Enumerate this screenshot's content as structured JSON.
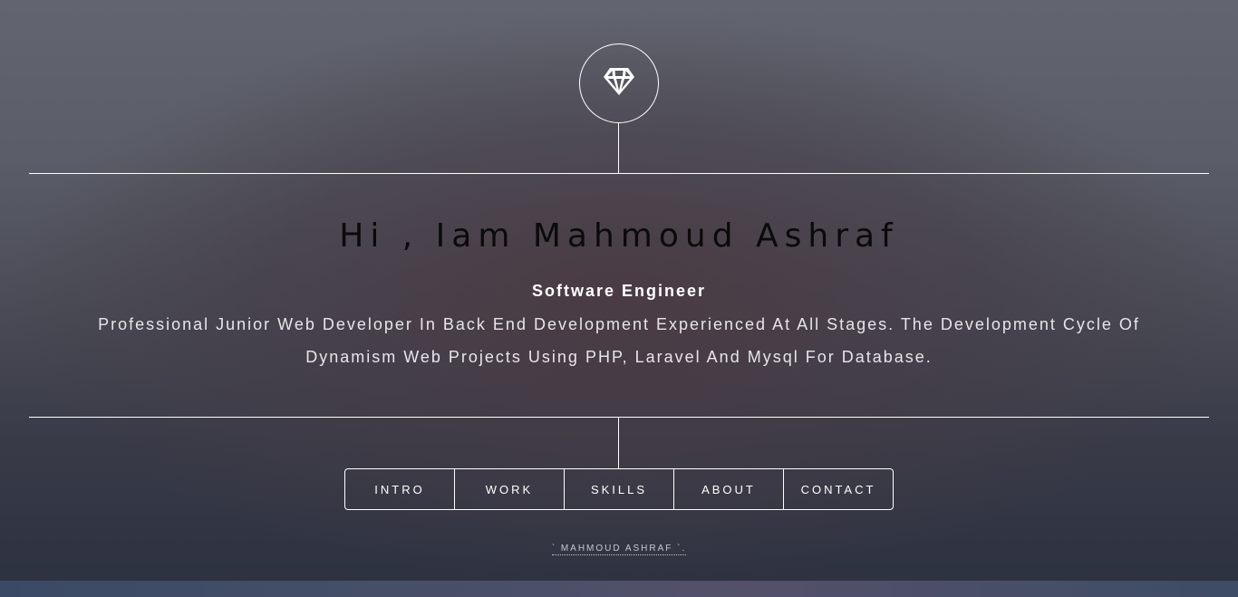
{
  "logo": {
    "icon": "diamond-icon"
  },
  "header": {
    "headline": "Hi , Iam Mahmoud Ashraf",
    "role": "Software Engineer",
    "description_line1": "Professional Junior Web Developer In Back End Development Experienced At All Stages. The Development Cycle Of",
    "description_line2": "Dynamism Web Projects Using PHP, Laravel And Mysql For Database."
  },
  "nav": {
    "items": [
      {
        "label": "INTRO"
      },
      {
        "label": "WORK"
      },
      {
        "label": "SKILLS"
      },
      {
        "label": "ABOUT"
      },
      {
        "label": "CONTACT"
      }
    ]
  },
  "footer": {
    "credit": "` MAHMOUD ASHRAF `."
  },
  "colors": {
    "line": "#ffffff",
    "headline": "#0a0a0a",
    "text": "#ffffff"
  }
}
